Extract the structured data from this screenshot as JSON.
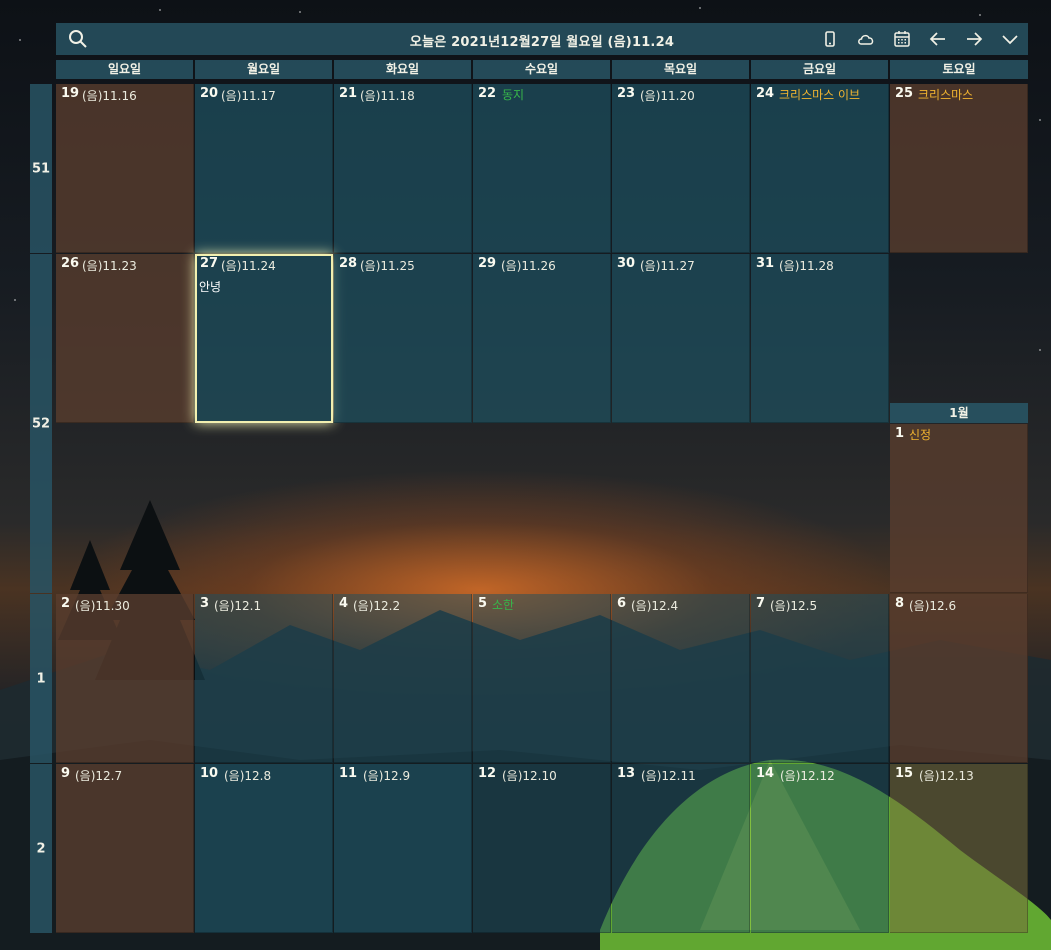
{
  "header": {
    "title": "오늘은 2021년12월27일 월요일 (음)11.24"
  },
  "weekdays": [
    "일요일",
    "월요일",
    "화요일",
    "수요일",
    "목요일",
    "금요일",
    "토요일"
  ],
  "weeks": [
    "51",
    "52",
    "1",
    "2"
  ],
  "next_month_label": "1월",
  "row1": {
    "d0": "19",
    "l0": "(음)11.16",
    "d1": "20",
    "l1": "(음)11.17",
    "d2": "21",
    "l2": "(음)11.18",
    "d3": "22",
    "s3": "동지",
    "d4": "23",
    "l4": "(음)11.20",
    "d5": "24",
    "h5": "크리스마스 이브",
    "d6": "25",
    "h6": "크리스마스"
  },
  "row2": {
    "d0": "26",
    "l0": "(음)11.23",
    "d1": "27",
    "l1": "(음)11.24",
    "e1": "안녕",
    "d2": "28",
    "l2": "(음)11.25",
    "d3": "29",
    "l3": "(음)11.26",
    "d4": "30",
    "l4": "(음)11.27",
    "d5": "31",
    "l5": "(음)11.28",
    "d6": "1",
    "h6": "신정"
  },
  "row3": {
    "d0": "2",
    "l0": "(음)11.30",
    "d1": "3",
    "l1": "(음)12.1",
    "d2": "4",
    "l2": "(음)12.2",
    "d3": "5",
    "s3": "소한",
    "d4": "6",
    "l4": "(음)12.4",
    "d5": "7",
    "l5": "(음)12.5",
    "d6": "8",
    "l6": "(음)12.6"
  },
  "row4": {
    "d0": "9",
    "l0": "(음)12.7",
    "d1": "10",
    "l1": "(음)12.8",
    "d2": "11",
    "l2": "(음)12.9",
    "d3": "12",
    "l3": "(음)12.10",
    "d4": "13",
    "l4": "(음)12.11",
    "d5": "14",
    "l5": "(음)12.12",
    "d6": "15",
    "l6": "(음)12.13"
  },
  "colors": {
    "holiday": "#f2b530",
    "solar_term": "#37b54a",
    "header_bg": "#285464",
    "today_border": "#f2f0b0"
  },
  "icons": [
    "search-icon",
    "phone-icon",
    "cloud-icon",
    "calendar-icon",
    "arrow-left-icon",
    "arrow-right-icon",
    "chevron-down-icon"
  ]
}
